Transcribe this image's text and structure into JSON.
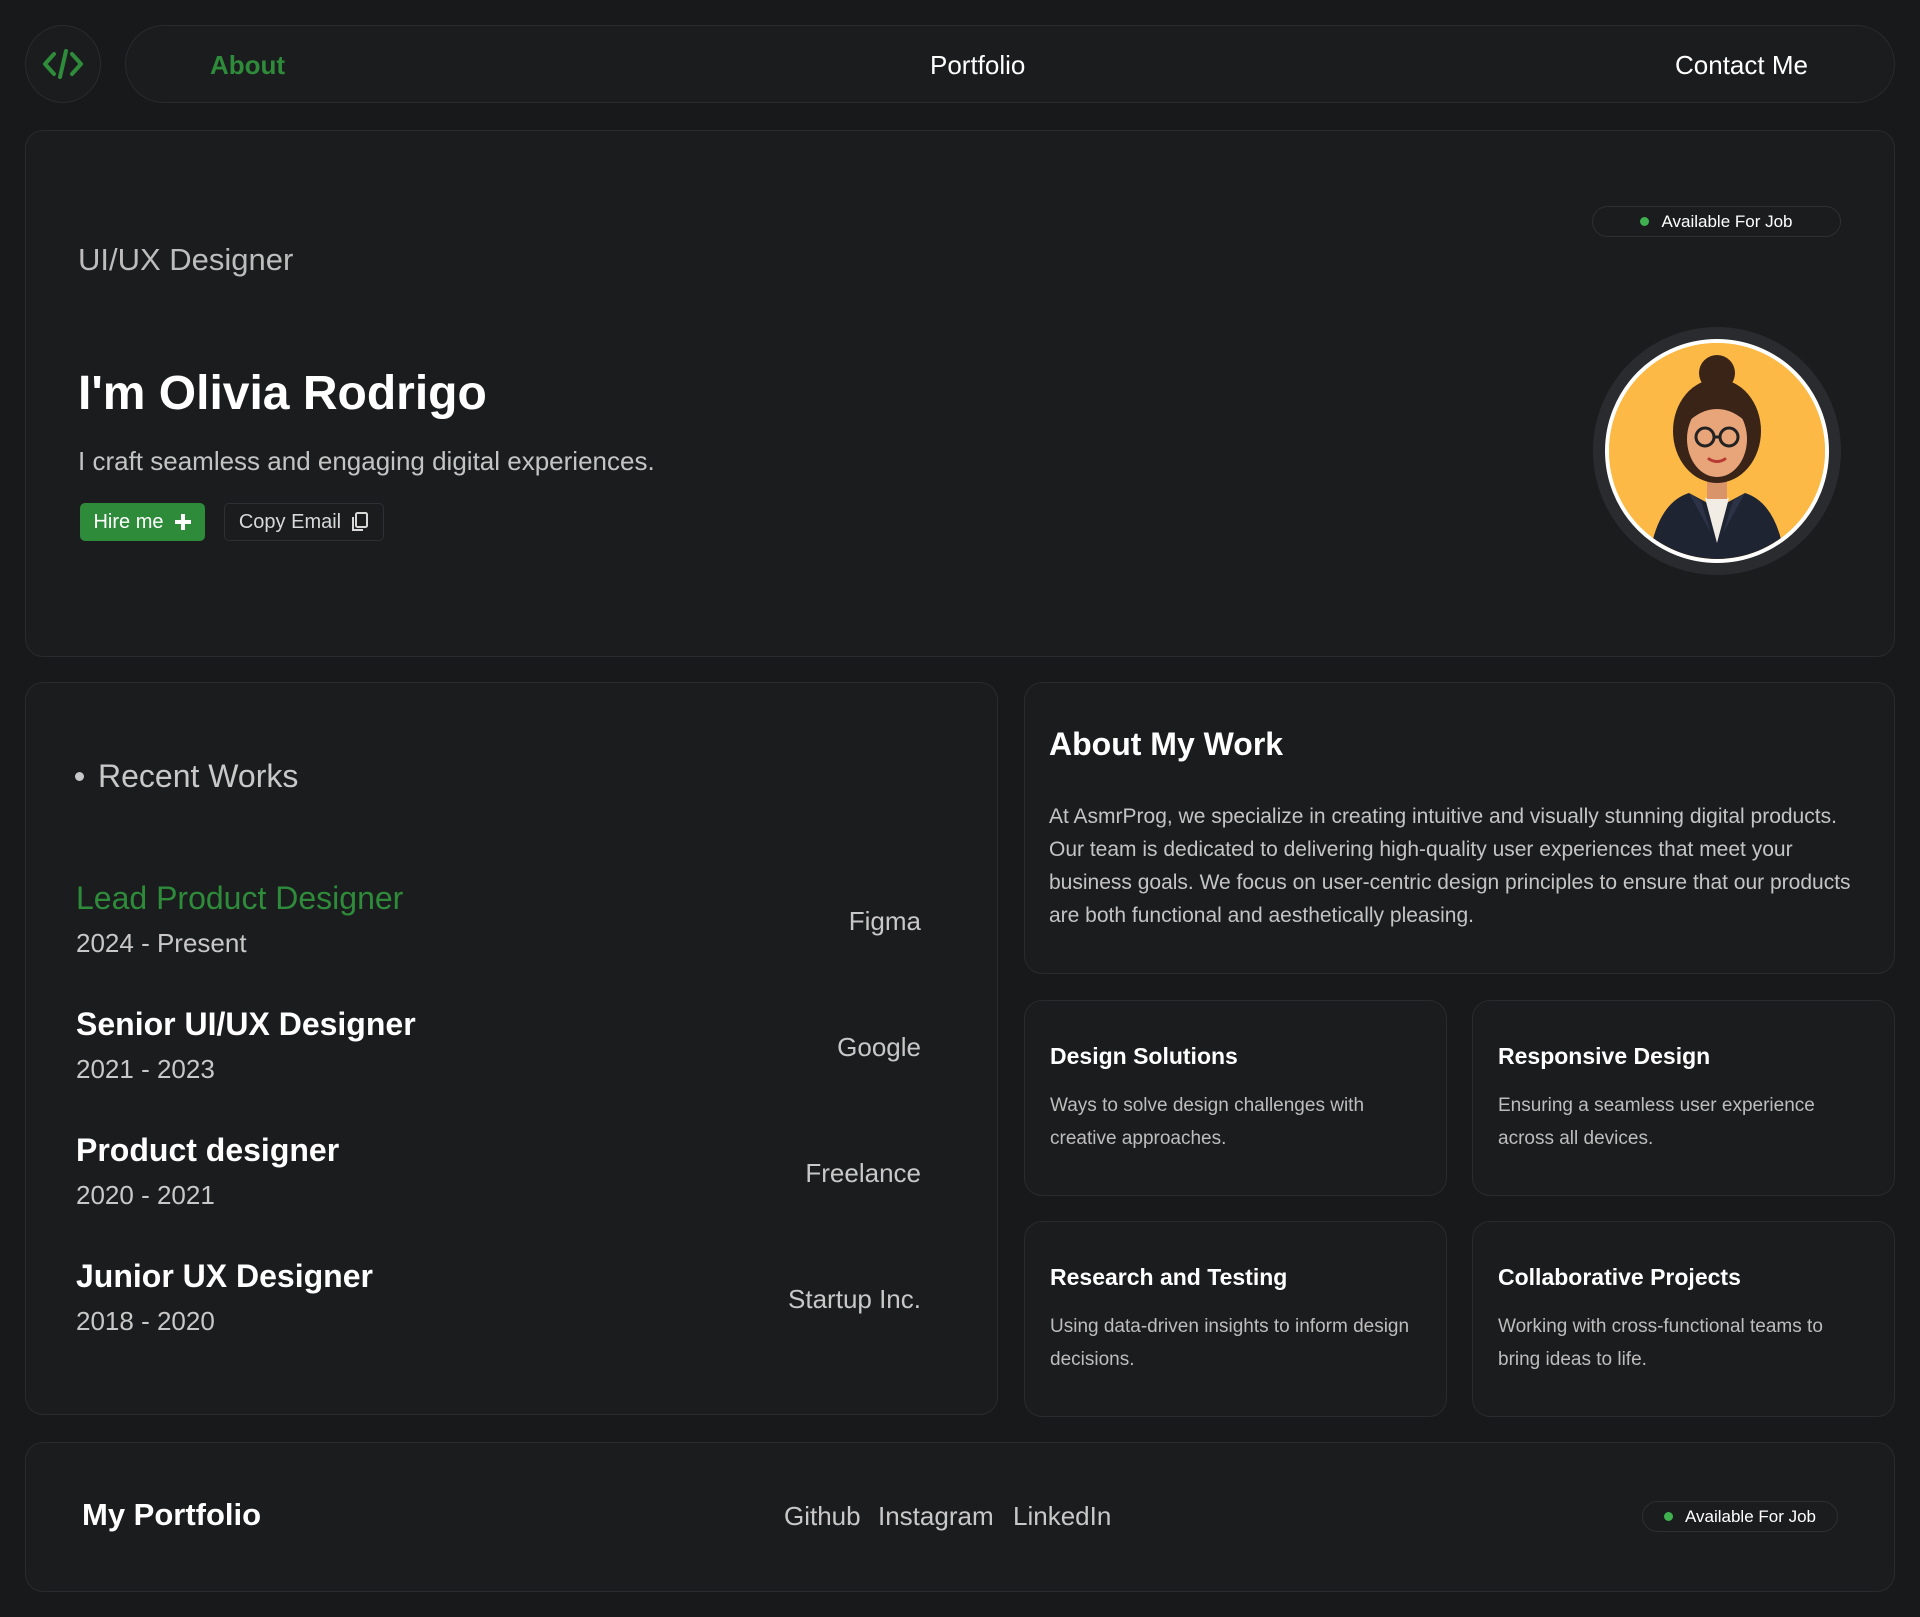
{
  "nav": {
    "logo_icon": "code-brackets-icon",
    "about": "About",
    "portfolio": "Portfolio",
    "contact": "Contact Me"
  },
  "hero": {
    "badge": "Available For Job",
    "role": "UI/UX Designer",
    "name": "I'm Olivia Rodrigo",
    "tagline": "I craft seamless and engaging digital experiences.",
    "hire_label": "Hire me",
    "hire_icon": "plus-icon",
    "copy_label": "Copy Email",
    "copy_icon": "copy-icon",
    "avatar_icon": "woman-avatar-illustration"
  },
  "recent_works": {
    "title": "Recent Works",
    "jobs": [
      {
        "title": "Lead Product Designer",
        "dates": "2024 - Present",
        "company": "Figma"
      },
      {
        "title": "Senior UI/UX Designer",
        "dates": "2021 - 2023",
        "company": "Google"
      },
      {
        "title": "Product designer",
        "dates": "2020 - 2021",
        "company": "Freelance"
      },
      {
        "title": "Junior UX Designer",
        "dates": "2018 - 2020",
        "company": "Startup Inc."
      }
    ]
  },
  "about_work": {
    "title": "About My Work",
    "body": "At AsmrProg, we specialize in creating intuitive and visually stunning digital products. Our team is dedicated to delivering high-quality user experiences that meet your business goals. We focus on user-centric design principles to ensure that our products are both functional and aesthetically pleasing."
  },
  "features": [
    {
      "title": "Design Solutions",
      "desc": "Ways to solve design challenges with creative approaches."
    },
    {
      "title": "Responsive Design",
      "desc": "Ensuring a seamless user experience across all devices."
    },
    {
      "title": "Research and Testing",
      "desc": "Using data-driven insights to inform design decisions."
    },
    {
      "title": "Collaborative Projects",
      "desc": "Working with cross-functional teams to bring ideas to life."
    }
  ],
  "footer": {
    "title": "My Portfolio",
    "links": [
      "Github",
      "Instagram",
      "LinkedIn"
    ],
    "badge": "Available For Job"
  },
  "colors": {
    "background": "#18191b",
    "card": "#1b1c1e",
    "accent": "#2e8b3a",
    "status_dot": "#3fb24f",
    "avatar_bg": "#fdb945"
  }
}
